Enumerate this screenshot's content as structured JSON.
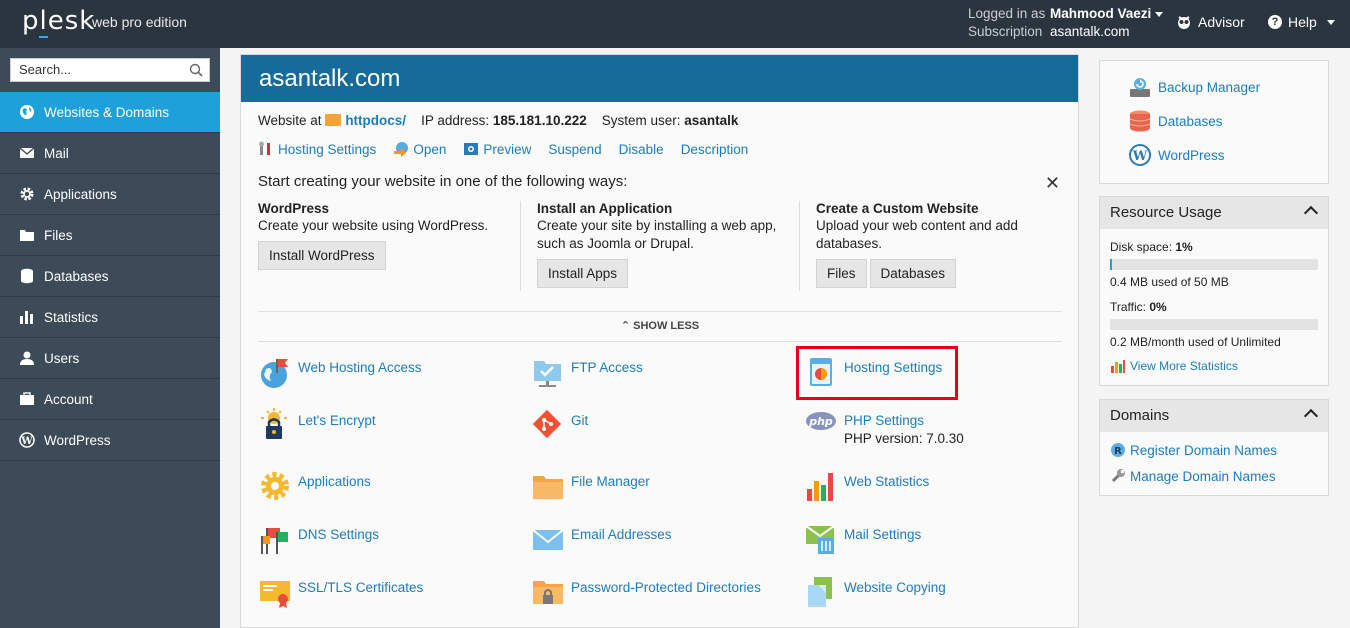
{
  "topbar": {
    "logo": "plesk",
    "edition": "web pro edition",
    "logged_in_label": "Logged in as",
    "user_name": "Mahmood Vaezi",
    "subscription_label": "Subscription",
    "subscription_value": "asantalk.com",
    "advisor_label": "Advisor",
    "help_label": "Help"
  },
  "sidebar": {
    "search_placeholder": "Search...",
    "items": [
      {
        "label": "Websites & Domains",
        "icon": "globe-icon",
        "active": true
      },
      {
        "label": "Mail",
        "icon": "mail-icon"
      },
      {
        "label": "Applications",
        "icon": "gear-icon"
      },
      {
        "label": "Files",
        "icon": "folder-icon"
      },
      {
        "label": "Databases",
        "icon": "database-icon"
      },
      {
        "label": "Statistics",
        "icon": "bar-chart-icon"
      },
      {
        "label": "Users",
        "icon": "user-icon"
      },
      {
        "label": "Account",
        "icon": "account-icon"
      },
      {
        "label": "WordPress",
        "icon": "wordpress-icon"
      }
    ]
  },
  "main": {
    "domain_title": "asantalk.com",
    "website_at_label": "Website at",
    "docroot_link": "httpdocs/",
    "ip_label": "IP address:",
    "ip_value": "185.181.10.222",
    "sysuser_label": "System user:",
    "sysuser_value": "asantalk",
    "actions": [
      "Hosting Settings",
      "Open",
      "Preview",
      "Suspend",
      "Disable",
      "Description"
    ],
    "start": {
      "title": "Start creating your website in one of the following ways:",
      "columns": [
        {
          "heading": "WordPress",
          "line1": "Create your website using WordPress.",
          "line2": "",
          "buttons": [
            "Install WordPress"
          ]
        },
        {
          "heading": "Install an Application",
          "line1": "Create your site by installing a web app,",
          "line2": "such as Joomla or Drupal.",
          "buttons": [
            "Install Apps"
          ]
        },
        {
          "heading": "Create a Custom Website",
          "line1": "Upload your web content and add",
          "line2": "databases.",
          "buttons": [
            "Files",
            "Databases"
          ]
        }
      ],
      "show_less": "SHOW LESS"
    },
    "tools": [
      {
        "label": "Web Hosting Access",
        "sub": "",
        "icon": "globe-flag-icon"
      },
      {
        "label": "FTP Access",
        "sub": "",
        "icon": "ftp-folder-icon"
      },
      {
        "label": "Hosting Settings",
        "sub": "",
        "icon": "hosting-settings-icon"
      },
      {
        "label": "Let's Encrypt",
        "sub": "",
        "icon": "lock-sun-icon"
      },
      {
        "label": "Git",
        "sub": "",
        "icon": "git-icon"
      },
      {
        "label": "PHP Settings",
        "sub": "PHP version: 7.0.30",
        "icon": "php-icon"
      },
      {
        "label": "Applications",
        "sub": "",
        "icon": "gear-sun-icon"
      },
      {
        "label": "File Manager",
        "sub": "",
        "icon": "folder-icon"
      },
      {
        "label": "Web Statistics",
        "sub": "",
        "icon": "bar-chart-icon"
      },
      {
        "label": "DNS Settings",
        "sub": "",
        "icon": "dns-flags-icon"
      },
      {
        "label": "Email Addresses",
        "sub": "",
        "icon": "envelope-icon"
      },
      {
        "label": "Mail Settings",
        "sub": "",
        "icon": "mail-settings-icon"
      },
      {
        "label": "SSL/TLS Certificates",
        "sub": "",
        "icon": "certificate-icon"
      },
      {
        "label": "Password-Protected Directories",
        "sub": "",
        "icon": "locked-folder-icon"
      },
      {
        "label": "Website Copying",
        "sub": "",
        "icon": "copy-pages-icon"
      }
    ]
  },
  "right": {
    "quick_links": [
      {
        "label": "Backup Manager",
        "icon": "backup-icon"
      },
      {
        "label": "Databases",
        "icon": "database-icon"
      },
      {
        "label": "WordPress",
        "icon": "wordpress-icon"
      }
    ],
    "resource_usage": {
      "title": "Resource Usage",
      "disk_label": "Disk space:",
      "disk_pct": "1%",
      "disk_fraction": 0.01,
      "disk_detail": "0.4 MB used of 50 MB",
      "traffic_label": "Traffic:",
      "traffic_pct": "0%",
      "traffic_fraction": 0.0,
      "traffic_detail": "0.2 MB/month used of Unlimited",
      "more_link": "View More Statistics"
    },
    "domains": {
      "title": "Domains",
      "links": [
        "Register Domain Names",
        "Manage Domain Names"
      ]
    }
  },
  "colors": {
    "topbar": "#2b3540",
    "sidebar": "#3d4a57",
    "active": "#1ea0db",
    "header": "#176b98",
    "link": "#1d7cc0",
    "highlight": "#e5001a"
  }
}
